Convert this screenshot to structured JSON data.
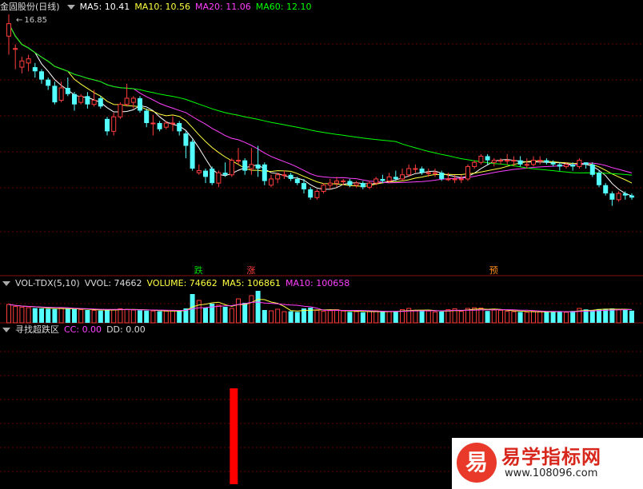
{
  "header_main": {
    "stock_label": "金固股份(日线)",
    "ma5": "MA5: 10.41",
    "ma10": "MA10: 10.56",
    "ma20": "MA20: 11.06",
    "ma60": "MA60: 12.10",
    "high_label": "16.85"
  },
  "header_vol": {
    "indicator": "VOL-TDX(5,10)",
    "vvol": "VVOL: 74662",
    "volume": "VOLUME: 74662",
    "ma5": "MA5: 106861",
    "ma10": "MA10: 100658"
  },
  "header_ind": {
    "indicator": "寻找超跌区",
    "cc": "CC: 0.00",
    "dd": "DD: 0.00"
  },
  "signals": [
    {
      "text": "跌",
      "index": 29,
      "color": "#00d800"
    },
    {
      "text": "涨",
      "index": 37,
      "color": "#ff3c3c"
    },
    {
      "text": "预",
      "index": 74,
      "color": "#ff8c1a"
    }
  ],
  "watermark": {
    "logo_char": "易",
    "name": "易学指标网",
    "url": "www.108096.com"
  },
  "colors": {
    "up": "#ff3c3c",
    "down": "#54ffff",
    "ma5": "#ffffff",
    "ma10": "#ffff40",
    "ma20": "#ff40ff",
    "ma60": "#00ff00",
    "grid": "#6a0000",
    "signal_bar": "#ff0000"
  },
  "chart_data": {
    "type": "candlestick",
    "max_price": 16.85,
    "ohlc": [
      [
        15.8,
        16.4,
        14.9,
        16.85
      ],
      [
        15.2,
        15.2,
        14.2,
        15.4
      ],
      [
        14.3,
        14.6,
        14.0,
        14.8
      ],
      [
        14.5,
        14.7,
        14.1,
        14.9
      ],
      [
        14.3,
        14.1,
        13.8,
        14.5
      ],
      [
        14.1,
        13.7,
        13.5,
        14.2
      ],
      [
        13.7,
        13.4,
        13.2,
        13.8
      ],
      [
        13.4,
        12.6,
        12.5,
        13.6
      ],
      [
        12.7,
        13.3,
        12.6,
        13.6
      ],
      [
        13.3,
        13.0,
        12.9,
        13.8
      ],
      [
        13.0,
        12.5,
        12.2,
        13.1
      ],
      [
        12.6,
        12.9,
        12.5,
        13.0
      ],
      [
        12.9,
        12.5,
        12.3,
        13.1
      ],
      [
        12.5,
        12.7,
        12.4,
        13.2
      ],
      [
        12.8,
        12.4,
        12.3,
        12.9
      ],
      [
        11.8,
        11.2,
        11.0,
        11.9
      ],
      [
        11.2,
        11.9,
        11.0,
        12.1
      ],
      [
        11.9,
        12.5,
        11.8,
        12.6
      ],
      [
        12.5,
        12.8,
        12.4,
        13.5
      ],
      [
        12.6,
        12.8,
        12.3,
        12.9
      ],
      [
        12.8,
        12.2,
        12.1,
        12.9
      ],
      [
        12.2,
        11.6,
        11.4,
        12.3
      ],
      [
        11.6,
        11.6,
        11.0,
        12.0
      ],
      [
        11.6,
        11.3,
        11.2,
        11.7
      ],
      [
        11.4,
        11.6,
        11.3,
        11.7
      ],
      [
        11.6,
        11.6,
        11.2,
        11.9
      ],
      [
        11.6,
        11.2,
        11.0,
        11.7
      ],
      [
        11.1,
        10.5,
        9.9,
        11.2
      ],
      [
        10.7,
        9.4,
        9.3,
        10.8
      ],
      [
        9.2,
        9.3,
        9.1,
        9.6
      ],
      [
        9.3,
        9.0,
        8.7,
        9.4
      ],
      [
        9.4,
        8.7,
        8.6,
        9.5
      ],
      [
        8.7,
        9.2,
        8.5,
        9.3
      ],
      [
        9.2,
        9.1,
        9.0,
        9.7
      ],
      [
        9.1,
        9.8,
        9.0,
        9.9
      ],
      [
        9.8,
        9.8,
        9.6,
        10.4
      ],
      [
        9.8,
        9.3,
        9.1,
        9.9
      ],
      [
        9.4,
        9.6,
        9.1,
        10.4
      ],
      [
        9.6,
        9.4,
        9.0,
        10.5
      ],
      [
        9.6,
        8.8,
        8.6,
        9.7
      ],
      [
        8.6,
        8.9,
        8.5,
        9.1
      ],
      [
        8.9,
        9.1,
        8.7,
        9.2
      ],
      [
        9.1,
        9.1,
        8.9,
        9.3
      ],
      [
        9.1,
        8.9,
        8.8,
        9.2
      ],
      [
        8.9,
        8.7,
        8.6,
        9.0
      ],
      [
        8.7,
        8.4,
        8.2,
        8.9
      ],
      [
        8.4,
        8.0,
        7.9,
        8.5
      ],
      [
        8.0,
        8.3,
        7.9,
        8.4
      ],
      [
        8.3,
        8.6,
        8.2,
        8.7
      ],
      [
        8.6,
        8.7,
        8.4,
        8.9
      ],
      [
        8.7,
        8.8,
        8.5,
        9.0
      ],
      [
        8.8,
        8.8,
        8.6,
        8.9
      ],
      [
        8.8,
        8.6,
        8.5,
        8.9
      ],
      [
        8.6,
        8.7,
        8.5,
        8.8
      ],
      [
        8.7,
        8.5,
        8.4,
        8.8
      ],
      [
        8.5,
        8.7,
        8.4,
        8.8
      ],
      [
        8.7,
        8.9,
        8.6,
        9.0
      ],
      [
        8.9,
        8.8,
        8.7,
        9.1
      ],
      [
        8.8,
        9.0,
        8.7,
        9.2
      ],
      [
        9.0,
        8.9,
        8.8,
        9.3
      ],
      [
        8.9,
        9.1,
        8.8,
        9.4
      ],
      [
        9.1,
        9.4,
        9.0,
        9.6
      ],
      [
        9.4,
        9.4,
        9.2,
        9.6
      ],
      [
        9.4,
        9.2,
        9.1,
        9.5
      ],
      [
        9.2,
        9.2,
        9.0,
        9.4
      ],
      [
        9.2,
        9.2,
        9.0,
        9.4
      ],
      [
        9.2,
        8.9,
        8.8,
        9.3
      ],
      [
        8.9,
        8.9,
        8.8,
        9.2
      ],
      [
        8.9,
        8.9,
        8.7,
        9.1
      ],
      [
        8.9,
        8.9,
        8.7,
        9.1
      ],
      [
        8.9,
        9.5,
        8.8,
        9.6
      ],
      [
        9.5,
        9.7,
        9.4,
        9.8
      ],
      [
        9.7,
        10.0,
        9.6,
        10.1
      ],
      [
        10.0,
        9.8,
        9.6,
        10.1
      ],
      [
        9.7,
        9.8,
        9.5,
        9.9
      ],
      [
        9.8,
        9.8,
        9.6,
        9.9
      ],
      [
        9.8,
        9.8,
        9.6,
        10.1
      ],
      [
        9.8,
        9.8,
        9.5,
        10.0
      ],
      [
        9.8,
        9.6,
        9.5,
        10.0
      ],
      [
        9.6,
        9.6,
        9.4,
        9.9
      ],
      [
        9.6,
        9.8,
        9.5,
        10.0
      ],
      [
        9.8,
        9.8,
        9.6,
        10.0
      ],
      [
        9.8,
        9.7,
        9.6,
        9.9
      ],
      [
        9.7,
        9.6,
        9.5,
        9.8
      ],
      [
        9.6,
        9.5,
        9.3,
        9.7
      ],
      [
        9.5,
        9.6,
        9.4,
        9.7
      ],
      [
        9.6,
        9.5,
        9.3,
        9.7
      ],
      [
        9.5,
        9.8,
        9.4,
        9.9
      ],
      [
        9.7,
        9.6,
        9.4,
        9.7
      ],
      [
        9.6,
        9.1,
        9.0,
        9.7
      ],
      [
        9.2,
        8.6,
        8.5,
        9.3
      ],
      [
        8.6,
        8.2,
        8.1,
        8.7
      ],
      [
        8.2,
        7.9,
        7.6,
        8.3
      ],
      [
        7.9,
        8.2,
        7.8,
        8.3
      ],
      [
        8.2,
        8.1,
        7.9,
        8.3
      ],
      [
        8.1,
        8.0,
        7.9,
        8.2
      ]
    ],
    "volume": [
      115000,
      102000,
      98000,
      95000,
      92000,
      90000,
      88000,
      86000,
      92000,
      88000,
      85000,
      82000,
      80000,
      78000,
      76000,
      85000,
      82000,
      88000,
      84000,
      80000,
      78000,
      76000,
      74000,
      72000,
      73000,
      75000,
      76000,
      90000,
      180000,
      140000,
      95000,
      120000,
      110000,
      100000,
      90000,
      150000,
      125000,
      170000,
      200000,
      80000,
      75000,
      85000,
      70000,
      72000,
      68000,
      90000,
      95000,
      78000,
      72000,
      76000,
      82000,
      74000,
      68000,
      70000,
      66000,
      72000,
      75000,
      68000,
      70000,
      72000,
      82000,
      90000,
      78000,
      76000,
      74000,
      68000,
      70000,
      82000,
      88000,
      72000,
      90000,
      94000,
      92000,
      74000,
      80000,
      78000,
      72000,
      70000,
      68000,
      66000,
      72000,
      70000,
      68000,
      70000,
      72000,
      66000,
      74000,
      90000,
      84000,
      80000,
      86000,
      88000,
      90000,
      82000,
      80000,
      76000
    ],
    "cc_bars": [
      {
        "index": 34,
        "value": 1
      }
    ]
  }
}
